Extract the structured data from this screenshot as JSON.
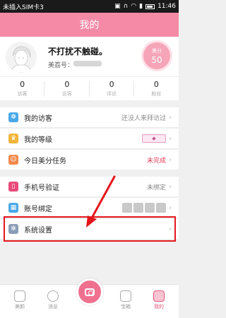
{
  "status_bar": {
    "carrier": "未插入SIM卡3",
    "time": "11:46"
  },
  "header": {
    "title": "我的"
  },
  "profile": {
    "nickname": "不打扰不触碰。",
    "meizhuang_label": "美荔号：",
    "score_label": "美分",
    "score_value": "50"
  },
  "stats": [
    {
      "value": "0",
      "label": "访客"
    },
    {
      "value": "0",
      "label": "访客"
    },
    {
      "value": "0",
      "label": "评论"
    },
    {
      "value": "0",
      "label": "粉丝"
    }
  ],
  "menu_group1": [
    {
      "label": "我的访客",
      "value": "还没人来拜访过",
      "icon": "footprint-icon",
      "color": "#4aa8e8"
    },
    {
      "label": "我的等级",
      "value": "",
      "icon": "crown-icon",
      "color": "#f2b53a"
    },
    {
      "label": "今日美分任务",
      "value": "未完成",
      "icon": "task-icon",
      "color": "#f3884a"
    }
  ],
  "menu_group2": [
    {
      "label": "手机号验证",
      "value": "未绑定",
      "icon": "phone-icon",
      "color": "#e8497a"
    },
    {
      "label": "账号绑定",
      "value": "",
      "icon": "link-icon",
      "color": "#4aa8e8"
    },
    {
      "label": "系统设置",
      "value": "",
      "icon": "gear-icon",
      "color": "#8b9db5"
    }
  ],
  "nav": {
    "items": [
      "美颜",
      "消息",
      "",
      "宝箱",
      "我的"
    ]
  }
}
